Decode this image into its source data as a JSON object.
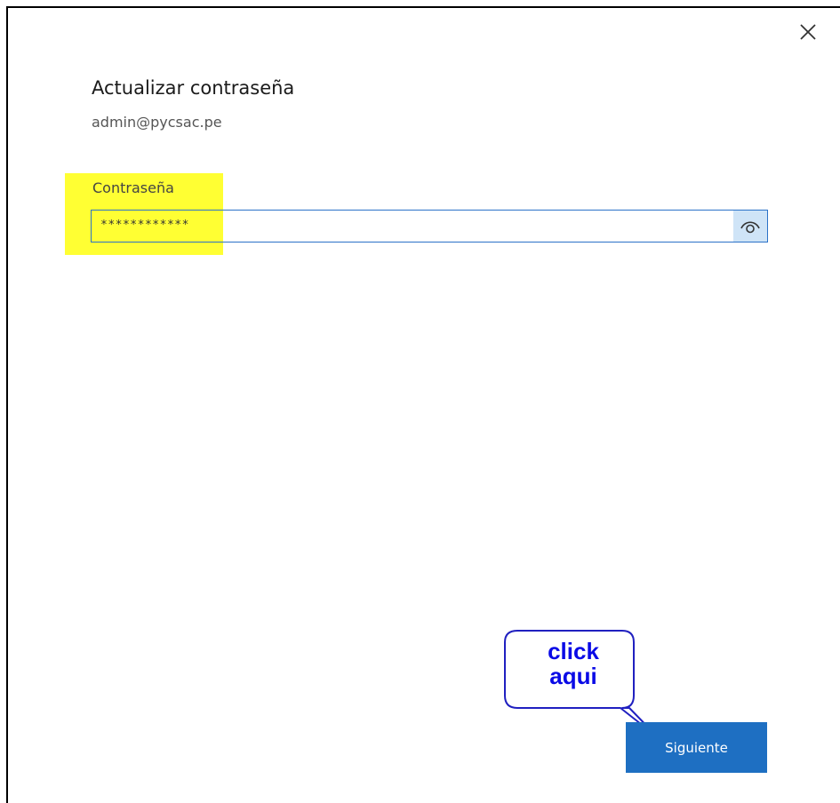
{
  "dialog": {
    "title": "Actualizar contraseña",
    "account": "admin@pycsac.pe",
    "close_icon": "close-icon"
  },
  "password": {
    "label": "Contraseña",
    "value": "************",
    "reveal_icon": "eye-icon"
  },
  "actions": {
    "next_label": "Siguiente"
  },
  "annotation": {
    "callout_line1": "click",
    "callout_line2": "aqui"
  },
  "colors": {
    "accent": "#1e6fc2",
    "highlight": "#ffff33",
    "callout_text": "#0a0ae6",
    "callout_border": "#2020c0"
  }
}
